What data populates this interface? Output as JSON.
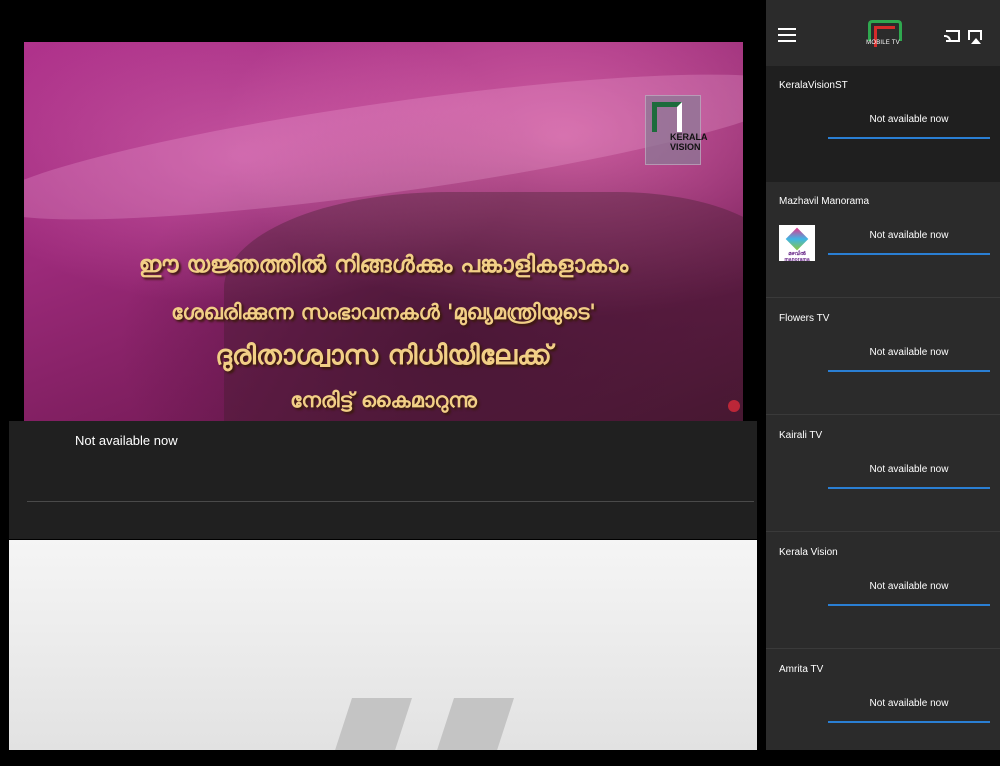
{
  "player": {
    "overlay_lines": [
      "ഈ യജ്ഞത്തിൽ നിങ്ങൾക്കും പങ്കാളികളാകാം",
      "ശേഖരിക്കുന്ന സംഭാവനകൾ 'മുഖ്യമന്ത്രിയുടെ'",
      "ദുരിതാശ്വാസ നിധിയിലേക്ക്",
      "നേരിട്ട് കൈമാറുന്നു"
    ],
    "watermark_text": "KERALA VISION",
    "status": "Not available now"
  },
  "sidebar": {
    "logo_text": "MOBILE TV",
    "channels": [
      {
        "name": "KeralaVisionST",
        "status": "Not available now",
        "has_thumb": false
      },
      {
        "name": "Mazhavil Manorama",
        "status": "Not available now",
        "has_thumb": true,
        "thumb_text": "മഴവിൽ manorama"
      },
      {
        "name": "Flowers TV",
        "status": "Not available now",
        "has_thumb": false
      },
      {
        "name": "Kairali TV",
        "status": "Not available now",
        "has_thumb": false
      },
      {
        "name": "Kerala Vision",
        "status": "Not available now",
        "has_thumb": false
      },
      {
        "name": "Amrita TV",
        "status": "Not available now",
        "has_thumb": false
      }
    ]
  },
  "colors": {
    "accent_bar": "#2a7fd4",
    "sidebar_bg": "#2b2b2b",
    "overlay_text": "#f2cf86"
  }
}
